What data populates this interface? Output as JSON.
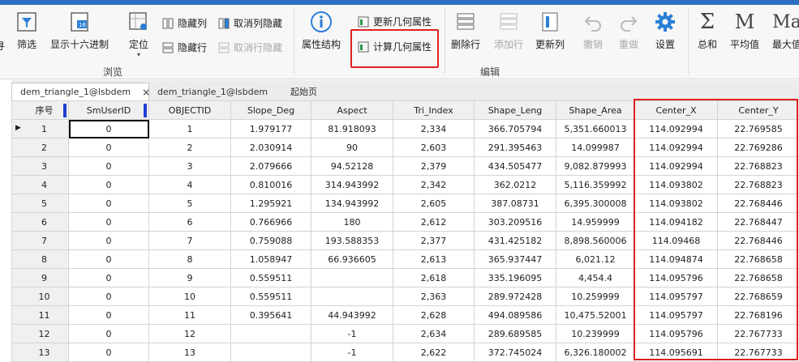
{
  "ribbon": {
    "browse_group": "浏览",
    "edit_group": "编辑",
    "filter": "筛选",
    "hex": "显示十六进制",
    "locate": "定位",
    "hide_col": "隐藏列",
    "unhide_col": "取消列隐藏",
    "hide_row": "隐藏行",
    "unhide_row": "取消行隐藏",
    "attr_struct": "属性结构",
    "update_geom": "更新几何属性",
    "calc_geom": "计算几何属性",
    "delete_row": "删除行",
    "add_row": "添加行",
    "update_col": "更新列",
    "undo": "撤销",
    "redo": "重做",
    "settings": "设置",
    "sum": "总和",
    "avg": "平均值",
    "max": "最大值",
    "sum_glyph": "Σ",
    "avg_glyph": "M",
    "max_glyph": "Ma"
  },
  "tabs": {
    "active": "dem_triangle_1@lsbdem",
    "close": "×",
    "second": "dem_triangle_1@lsbdem",
    "third": "起始页"
  },
  "table": {
    "columns": [
      "序号",
      "SmUserID",
      "OBJECTID",
      "Slope_Deg",
      "Aspect",
      "Tri_Index",
      "Shape_Leng",
      "Shape_Area",
      "Center_X",
      "Center_Y"
    ],
    "rows": [
      [
        "1",
        "0",
        "1",
        "1.979177",
        "81.918093",
        "2,334",
        "366.705794",
        "5,351.660013",
        "114.092994",
        "22.769585"
      ],
      [
        "2",
        "0",
        "2",
        "2.030914",
        "90",
        "2,603",
        "291.395463",
        "14.099987",
        "114.092994",
        "22.769286"
      ],
      [
        "3",
        "0",
        "3",
        "2.079666",
        "94.52128",
        "2,379",
        "434.505477",
        "9,082.879993",
        "114.092994",
        "22.768823"
      ],
      [
        "4",
        "0",
        "4",
        "0.810016",
        "314.943992",
        "2,342",
        "362.0212",
        "5,116.359992",
        "114.093802",
        "22.768823"
      ],
      [
        "5",
        "0",
        "5",
        "1.295921",
        "134.943992",
        "2,605",
        "387.08731",
        "6,395.300008",
        "114.093802",
        "22.768446"
      ],
      [
        "6",
        "0",
        "6",
        "0.766966",
        "180",
        "2,612",
        "303.209516",
        "14.959999",
        "114.094182",
        "22.768447"
      ],
      [
        "7",
        "0",
        "7",
        "0.759088",
        "193.588353",
        "2,377",
        "431.425182",
        "8,898.560006",
        "114.09468",
        "22.768446"
      ],
      [
        "8",
        "0",
        "8",
        "1.058947",
        "66.936605",
        "2,613",
        "365.937447",
        "6,021.12",
        "114.094874",
        "22.768658"
      ],
      [
        "9",
        "0",
        "9",
        "0.559511",
        "",
        "2,618",
        "335.196095",
        "4,454.4",
        "114.095796",
        "22.768658"
      ],
      [
        "10",
        "0",
        "10",
        "0.559511",
        "",
        "2,363",
        "289.972428",
        "10.259999",
        "114.095797",
        "22.768659"
      ],
      [
        "11",
        "0",
        "11",
        "0.395641",
        "44.943992",
        "2,628",
        "494.089586",
        "10,475.52001",
        "114.095797",
        "22.768196"
      ],
      [
        "12",
        "0",
        "12",
        "",
        "-1",
        "2,634",
        "289.689585",
        "10.239999",
        "114.095796",
        "22.767733"
      ],
      [
        "13",
        "0",
        "13",
        "",
        "-1",
        "2,622",
        "372.745024",
        "6,326.180002",
        "114.095691",
        "22.767733"
      ]
    ]
  }
}
